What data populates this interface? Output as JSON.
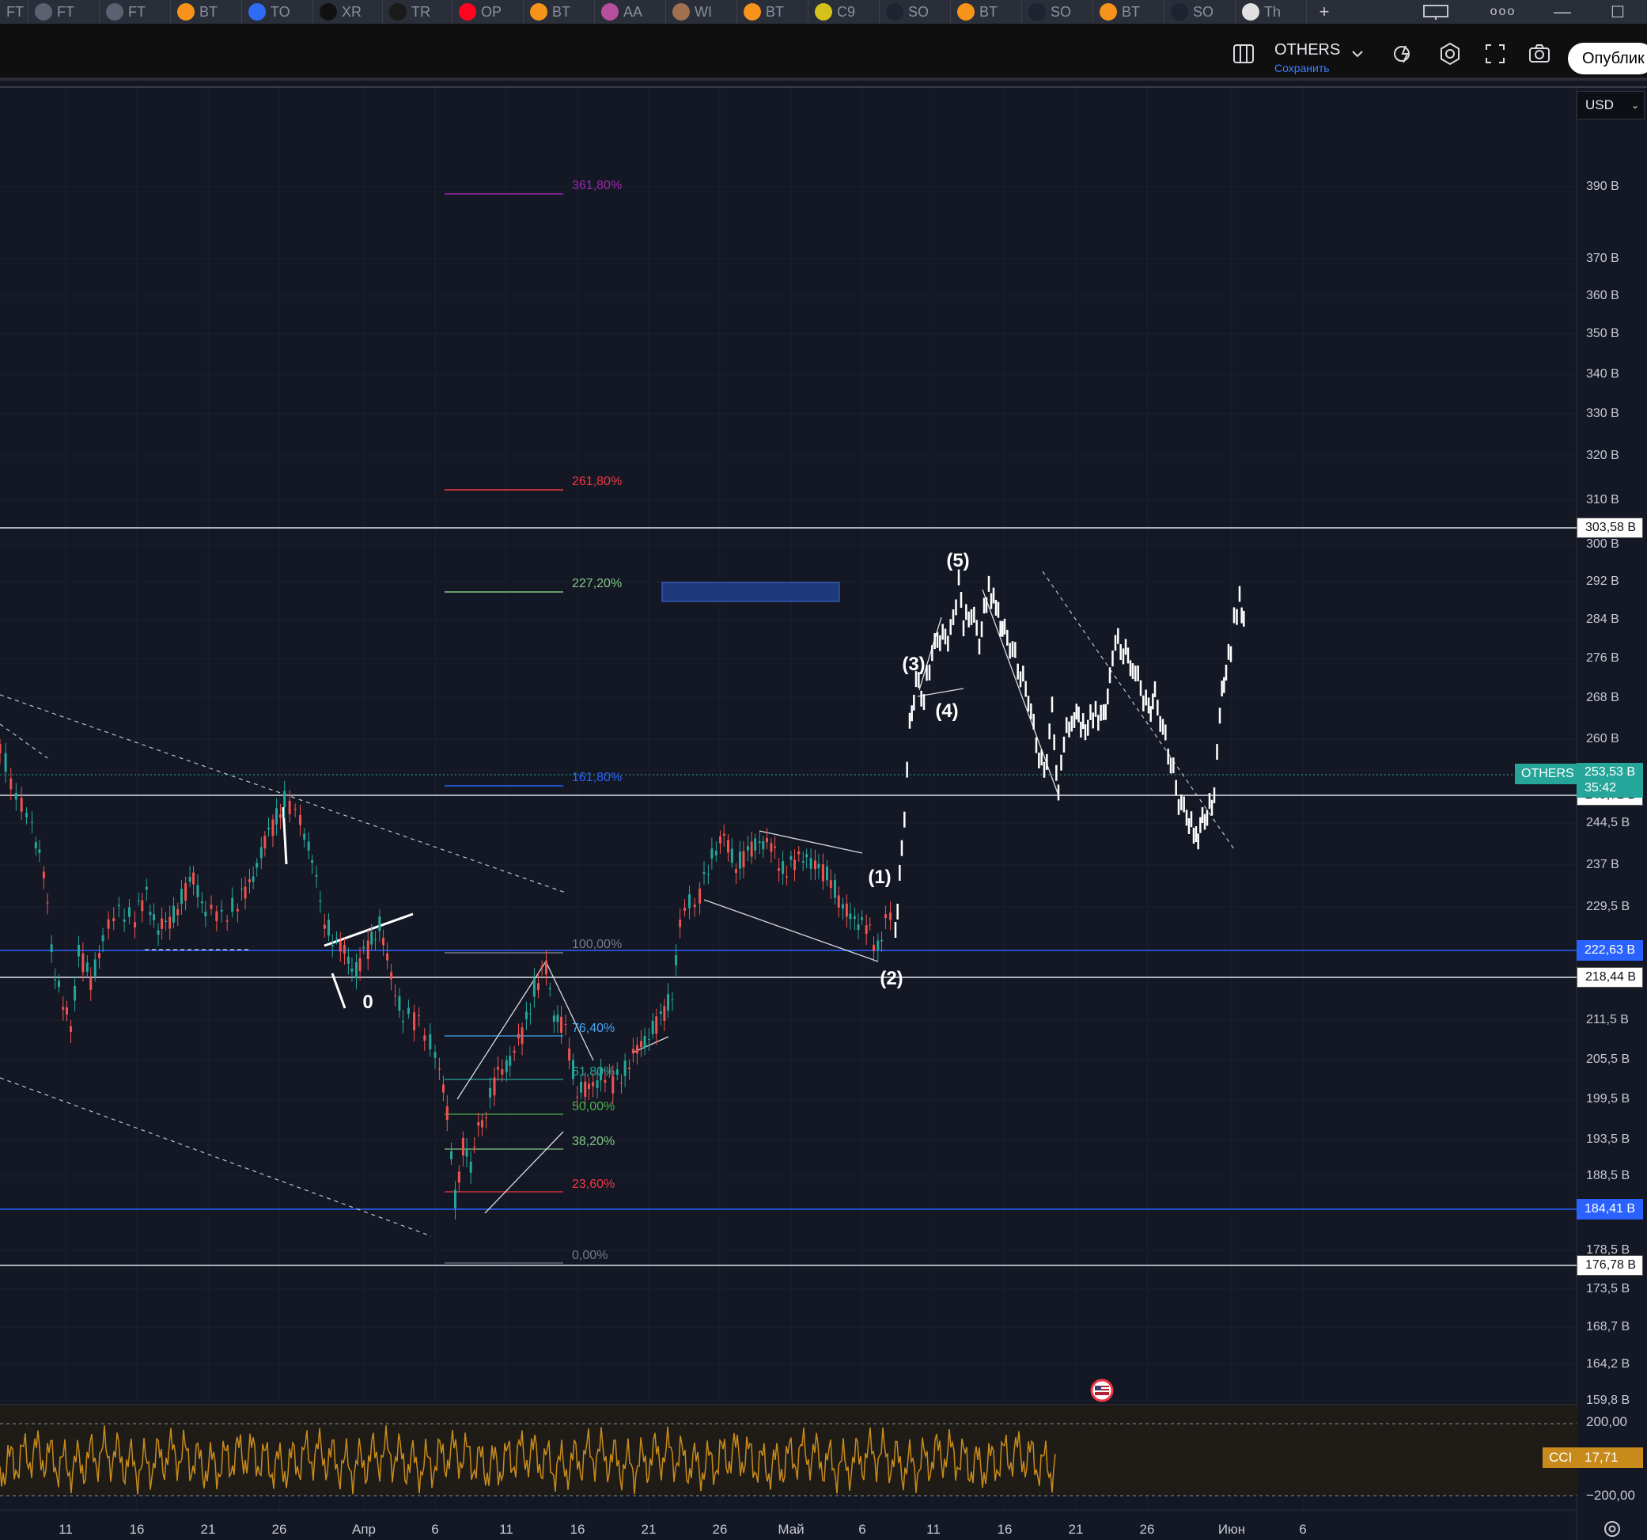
{
  "tabs": [
    {
      "label": "FT",
      "icon": "flag-icon",
      "color": "#3b3f4a"
    },
    {
      "label": "FT",
      "icon": "grey-circle-icon",
      "color": "#5c6070"
    },
    {
      "label": "FT",
      "icon": "grey-circle-icon",
      "color": "#5c6070"
    },
    {
      "label": "BT",
      "icon": "bitcoin-icon",
      "color": "#f7931a"
    },
    {
      "label": "TO",
      "icon": "toncoin-icon",
      "color": "#2e6cf6"
    },
    {
      "label": "XR",
      "icon": "xrp-icon",
      "color": "#111111"
    },
    {
      "label": "TR",
      "icon": "tron-icon",
      "color": "#1a1a1a"
    },
    {
      "label": "OP",
      "icon": "optimism-icon",
      "color": "#ff0420"
    },
    {
      "label": "BT",
      "icon": "bitcoin-icon",
      "color": "#f7931a"
    },
    {
      "label": "AA",
      "icon": "aave-icon",
      "color": "#b6509e"
    },
    {
      "label": "WI",
      "icon": "wif-icon",
      "color": "#a07050"
    },
    {
      "label": "BT",
      "icon": "bitcoin-icon",
      "color": "#f7931a"
    },
    {
      "label": "C9",
      "icon": "c98-icon",
      "color": "#d4c21a"
    },
    {
      "label": "SO",
      "icon": "solana-icon",
      "color": "#1d2330"
    },
    {
      "label": "BT",
      "icon": "bitcoin-icon",
      "color": "#f7931a"
    },
    {
      "label": "SO",
      "icon": "solana-icon",
      "color": "#1d2330"
    },
    {
      "label": "BT",
      "icon": "bitcoin-icon",
      "color": "#f7931a"
    },
    {
      "label": "SO",
      "icon": "solana-icon",
      "color": "#1d2330"
    },
    {
      "label": "Th",
      "icon": "tradingview-icon",
      "color": "#e0e0e0"
    }
  ],
  "toolbar": {
    "symbol": "OTHERS",
    "save_label": "Сохранить",
    "publish_label": "Опублик"
  },
  "currency": "USD",
  "chart_data": {
    "type": "candlestick",
    "symbol": "OTHERS",
    "price_axis": [
      "390 B",
      "370 B",
      "360 B",
      "350 B",
      "340 B",
      "330 B",
      "320 B",
      "310 B",
      "300 B",
      "292 B",
      "284 B",
      "276 B",
      "268 B",
      "260 B",
      "244,5 B",
      "237 B",
      "229,5 B",
      "211,5 B",
      "205,5 B",
      "199,5 B",
      "193,5 B",
      "188,5 B",
      "178,5 B",
      "173,5 B",
      "168,7 B",
      "164,2 B",
      "159,8 B"
    ],
    "date_axis": [
      "11",
      "16",
      "21",
      "26",
      "Апр",
      "6",
      "11",
      "16",
      "21",
      "26",
      "Май",
      "6",
      "11",
      "16",
      "21",
      "26",
      "Июн",
      "6"
    ],
    "current_price": "253,53 B",
    "countdown": "35:42",
    "horizontal_levels": [
      {
        "label": "303,58 B",
        "style": "white"
      },
      {
        "label": "249,72 B",
        "style": "white"
      },
      {
        "label": "222,63 B",
        "style": "blue"
      },
      {
        "label": "218,44 B",
        "style": "white"
      },
      {
        "label": "184,41 B",
        "style": "blue"
      },
      {
        "label": "176,78 B",
        "style": "white"
      }
    ],
    "fib_extension": [
      {
        "label": "361,80%",
        "color": "#9c27b0"
      },
      {
        "label": "261,80%",
        "color": "#f23645"
      },
      {
        "label": "227,20%",
        "color": "#81c784"
      },
      {
        "label": "161,80%",
        "color": "#2962ff"
      },
      {
        "label": "100,00%",
        "color": "#787b86"
      }
    ],
    "fib_retracement": [
      {
        "label": "76,40%",
        "color": "#42a5f5"
      },
      {
        "label": "61,80%",
        "color": "#26a69a"
      },
      {
        "label": "50,00%",
        "color": "#4caf50"
      },
      {
        "label": "38,20%",
        "color": "#81c784"
      },
      {
        "label": "23,60%",
        "color": "#f23645"
      },
      {
        "label": "0,00%",
        "color": "#787b86"
      }
    ],
    "wave_labels": [
      "(1)",
      "(2)",
      "(3)",
      "(4)",
      "(5)",
      "0"
    ],
    "indicator": {
      "name": "CCI",
      "value": "17,71",
      "upper": "200,00",
      "lower": "−200,00",
      "color": "#c88a1a"
    },
    "colors": {
      "up": "#26a69a",
      "down": "#ef5350",
      "projection": "#ffffff",
      "background": "#141824"
    }
  }
}
